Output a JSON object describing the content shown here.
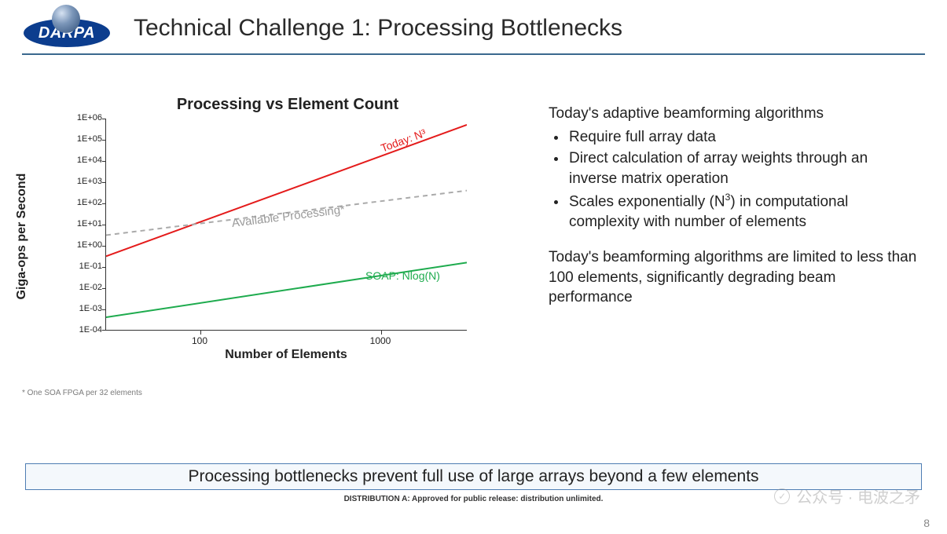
{
  "header": {
    "logo_text": "DARPA",
    "title": "Technical Challenge 1: Processing Bottlenecks"
  },
  "chart_data": {
    "type": "line",
    "title": "Processing vs Element Count",
    "xlabel": "Number of Elements",
    "ylabel": "Giga-ops per Second",
    "x_scale": "log",
    "y_scale": "log",
    "xlim": [
      30,
      3000
    ],
    "ylim": [
      0.0001,
      1000000.0
    ],
    "xticks": [
      100,
      1000
    ],
    "yticks_labels": [
      "1E-04",
      "1E-03",
      "1E-02",
      "1E-01",
      "1E+00",
      "1E+01",
      "1E+02",
      "1E+03",
      "1E+04",
      "1E+05",
      "1E+06"
    ],
    "series": [
      {
        "name": "Today: N³",
        "color": "#e41b1b",
        "style": "solid",
        "x": [
          30,
          3000
        ],
        "y": [
          0.3,
          500000.0
        ]
      },
      {
        "name": "SOAP: Nlog(N)",
        "color": "#1eab4e",
        "style": "solid",
        "x": [
          30,
          3000
        ],
        "y": [
          0.0004,
          0.15
        ]
      },
      {
        "name": "Available Processing*",
        "color": "#aaaaaa",
        "style": "dashed",
        "x": [
          30,
          3000
        ],
        "y": [
          3,
          400
        ]
      }
    ],
    "annotations": {
      "today_label": "Today: N³",
      "soap_label": "SOAP: Nlog(N)",
      "avail_label": "Available Processing*"
    },
    "footnote": "* One SOA FPGA per 32 elements"
  },
  "text": {
    "intro": "Today's adaptive beamforming algorithms",
    "bullet1": "Require full array data",
    "bullet2": "Direct calculation of array weights through an inverse matrix operation",
    "bullet3_a": "Scales exponentially (N",
    "bullet3_sup": "3",
    "bullet3_b": ") in computational complexity with number of elements",
    "para2": "Today's beamforming algorithms are limited to less than 100 elements, significantly degrading beam performance"
  },
  "callout": "Processing bottlenecks prevent full use of large arrays beyond a few elements",
  "distribution": "DISTRIBUTION A: Approved for public release: distribution unlimited.",
  "page_number": "8",
  "watermark": "公众号 · 电波之矛"
}
